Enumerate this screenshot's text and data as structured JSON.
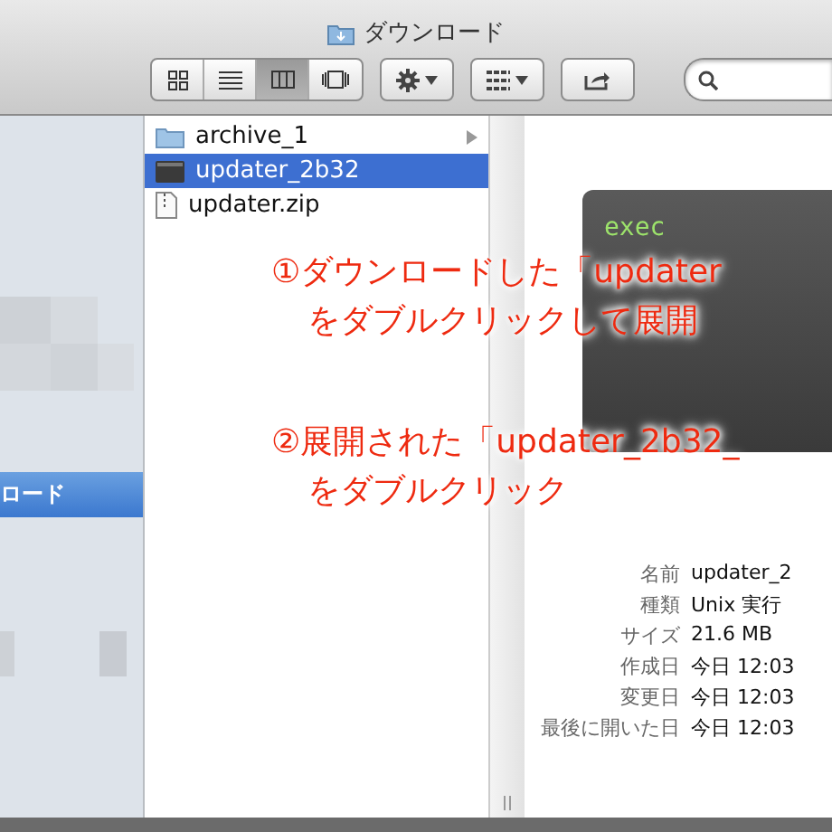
{
  "window": {
    "title": "ダウンロード"
  },
  "view_buttons": [
    {
      "kind": "icons",
      "selected": false
    },
    {
      "kind": "list",
      "selected": false
    },
    {
      "kind": "columns",
      "selected": true
    },
    {
      "kind": "coverflow",
      "selected": false
    }
  ],
  "sidebar": {
    "items": [
      {
        "label": "ロード",
        "selected": true
      }
    ]
  },
  "files": [
    {
      "name": "archive_1",
      "kind": "folder",
      "selected": false,
      "has_children": true
    },
    {
      "name": "updater_2b32",
      "kind": "executable",
      "selected": true,
      "has_children": false
    },
    {
      "name": "updater.zip",
      "kind": "zip",
      "selected": false,
      "has_children": false
    }
  ],
  "preview": {
    "label": "exec"
  },
  "info": [
    {
      "label": "名前",
      "value": "updater_2"
    },
    {
      "label": "種類",
      "value": "Unix 実行"
    },
    {
      "label": "サイズ",
      "value": "21.6 MB"
    },
    {
      "label": "作成日",
      "value": "今日 12:03"
    },
    {
      "label": "変更日",
      "value": "今日 12:03"
    },
    {
      "label": "最後に開いた日",
      "value": "今日 12:03"
    }
  ],
  "annotations": [
    {
      "lines": [
        "①ダウンロードした「updater",
        "をダブルクリックして展開"
      ]
    },
    {
      "lines": [
        "②展開された「updater_2b32_",
        "をダブルクリック"
      ]
    }
  ]
}
